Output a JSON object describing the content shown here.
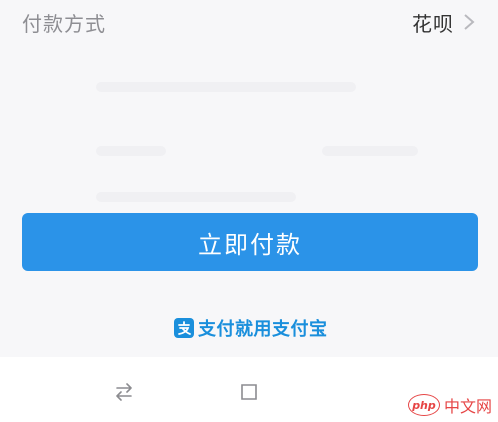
{
  "payment": {
    "label": "付款方式",
    "value": "花呗"
  },
  "actions": {
    "pay_now": "立即付款"
  },
  "brand": {
    "icon": "alipay-icon",
    "slogan": "支付就用支付宝",
    "color": "#1a8fdc"
  },
  "nav": {
    "icons": [
      "switch-arrows-icon",
      "square-icon"
    ]
  },
  "watermark": {
    "badge": "php",
    "text": "中文网",
    "color": "#e64545"
  },
  "colors": {
    "accent": "#2b93e8"
  }
}
